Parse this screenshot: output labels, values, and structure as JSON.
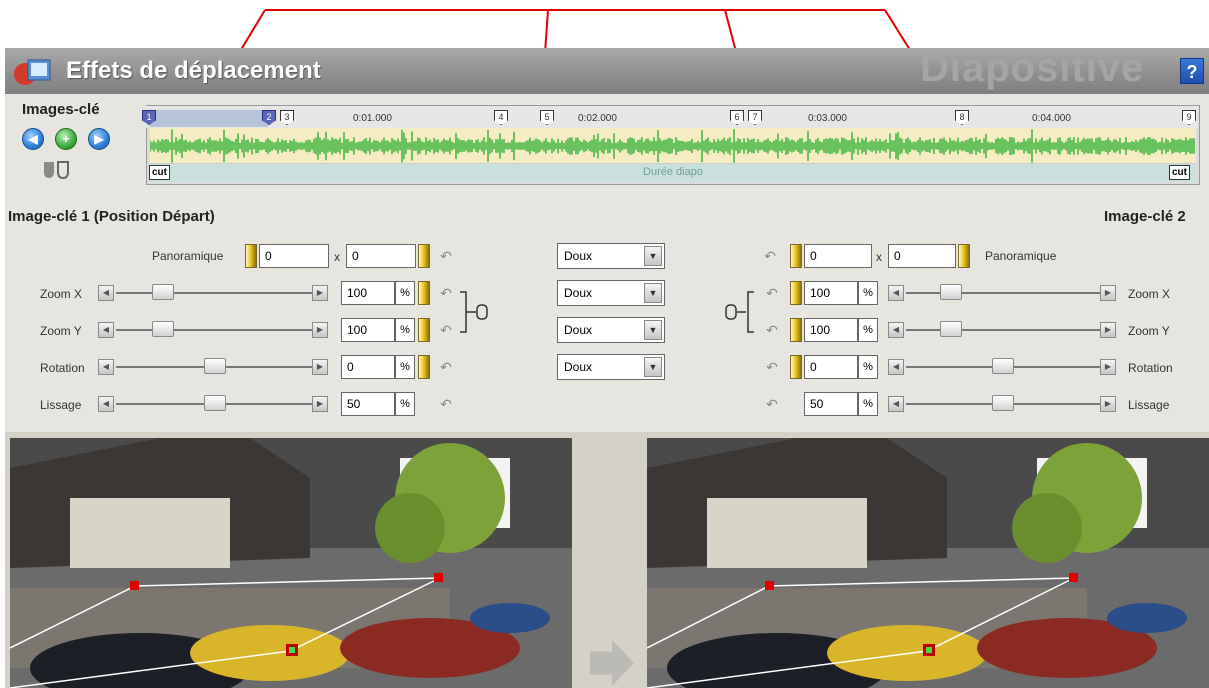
{
  "title": "Effets de déplacement",
  "watermark": "Diapositive",
  "help_label": "?",
  "keyframes_label": "Images-clé",
  "keyframe_buttons": [
    "◀",
    "+",
    "▶"
  ],
  "timeline": {
    "time_labels": [
      "0:01.000",
      "0:02.000",
      "0:03.000",
      "0:04.000"
    ],
    "markers": [
      {
        "label": "1",
        "active": true
      },
      {
        "label": "2",
        "active": true
      },
      {
        "label": "3",
        "active": false
      },
      {
        "label": "4",
        "active": false
      },
      {
        "label": "5",
        "active": false
      },
      {
        "label": "6",
        "active": false
      },
      {
        "label": "7",
        "active": false
      },
      {
        "label": "8",
        "active": false
      },
      {
        "label": "9",
        "active": false
      }
    ],
    "cut_left": "cut",
    "cut_right": "cut",
    "duration_label": "Durée diapo"
  },
  "start": {
    "title": "Image-clé 1 (Position Départ)",
    "pan_label": "Panoramique",
    "pan_x": "0",
    "pan_sep": "x",
    "pan_y": "0",
    "zoom_x_label": "Zoom X",
    "zoom_x": "100",
    "zoom_y_label": "Zoom Y",
    "zoom_y": "100",
    "rotation_label": "Rotation",
    "rotation": "0",
    "smooth_label": "Lissage",
    "smooth": "50",
    "pct": "%"
  },
  "end": {
    "title": "Image-clé 2",
    "pan_label": "Panoramique",
    "pan_x": "0",
    "pan_sep": "x",
    "pan_y": "0",
    "zoom_x_label": "Zoom X",
    "zoom_x": "100",
    "zoom_y_label": "Zoom Y",
    "zoom_y": "100",
    "rotation_label": "Rotation",
    "rotation": "0",
    "smooth_label": "Lissage",
    "smooth": "50",
    "pct": "%"
  },
  "easing": [
    "Doux",
    "Doux",
    "Doux",
    "Doux"
  ],
  "colors": {
    "annotation_arrow": "#e00000",
    "waveform": "#3cb43c",
    "marker_active": "#5a66b8"
  },
  "icons": {
    "reset": "↶",
    "link": "⊸",
    "arrow_left": "◀",
    "arrow_right": "▶",
    "dropdown": "▼"
  }
}
